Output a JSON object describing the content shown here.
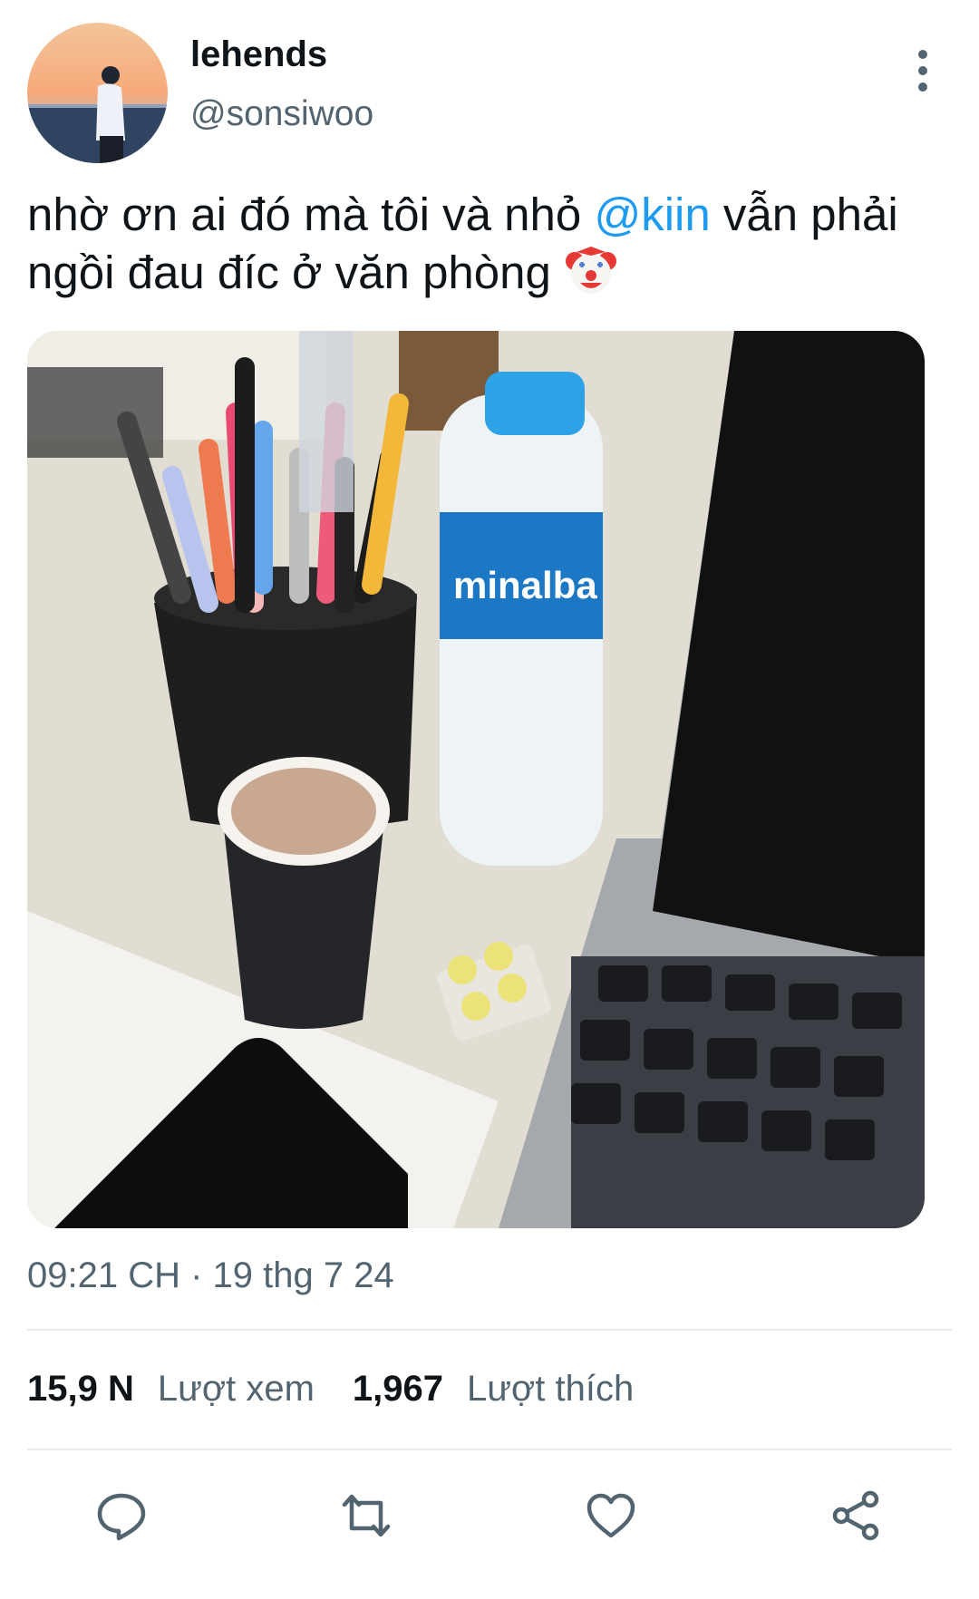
{
  "author": {
    "display_name": "lehends",
    "handle": "@sonsiwoo"
  },
  "tweet": {
    "text_before_mention": "nhờ ơn ai đó mà tôi và nhỏ ",
    "mention": "@kiin",
    "text_after_mention": " vẫn phải ngồi đau đíc ở văn phòng",
    "emoji": "clown-face"
  },
  "photo": {
    "bottle_label": "minalba"
  },
  "meta": {
    "timestamp": "09:21 CH · 19 thg 7 24"
  },
  "stats": {
    "views_count": "15,9 N",
    "views_label": "Lượt xem",
    "likes_count": "1,967",
    "likes_label": "Lượt thích"
  },
  "actions": [
    "reply",
    "retweet",
    "like",
    "share"
  ],
  "colors": {
    "accent": "#1d9bf0",
    "muted": "#536471",
    "text": "#0f1419",
    "divider": "#e6ebee"
  }
}
